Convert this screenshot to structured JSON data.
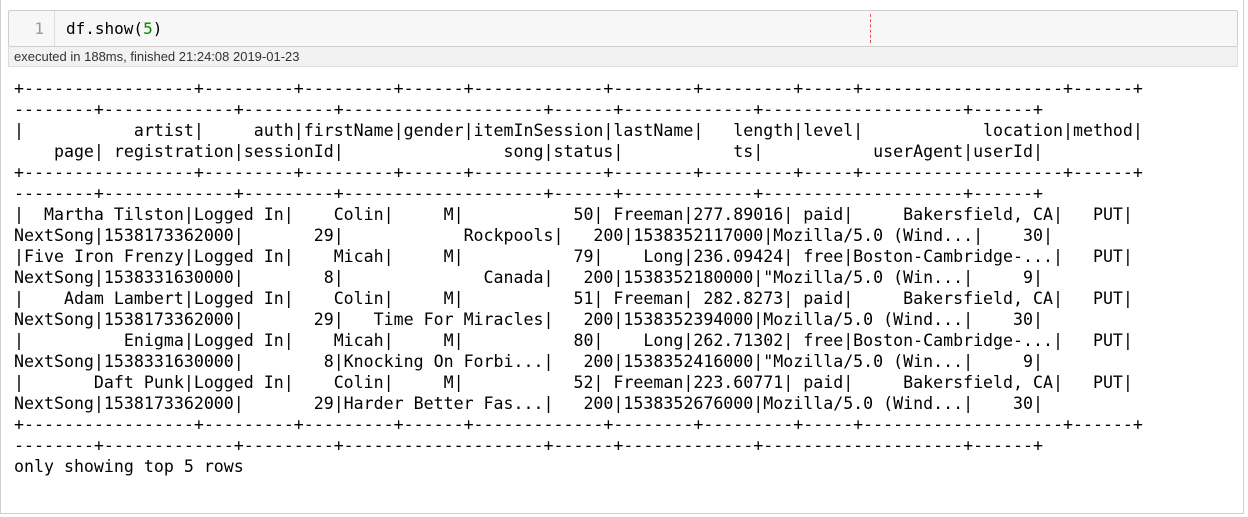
{
  "cell": {
    "line_number": "1",
    "code_prefix": "df.show(",
    "code_arg": "5",
    "code_suffix": ")",
    "execution_info": "executed in 188ms, finished 21:24:08 2019-01-23"
  },
  "output": {
    "lines": [
      "+-----------------+---------+---------+------+-------------+--------+---------+-----+--------------------+------+",
      "--------+-------------+---------+--------------------+------+-------------+--------------------+------+",
      "|           artist|     auth|firstName|gender|itemInSession|lastName|   length|level|            location|method|",
      "    page| registration|sessionId|                song|status|           ts|           userAgent|userId|",
      "+-----------------+---------+---------+------+-------------+--------+---------+-----+--------------------+------+",
      "--------+-------------+---------+--------------------+------+-------------+--------------------+------+",
      "|  Martha Tilston|Logged In|    Colin|     M|           50| Freeman|277.89016| paid|     Bakersfield, CA|   PUT|",
      "NextSong|1538173362000|       29|            Rockpools|   200|1538352117000|Mozilla/5.0 (Wind...|    30|",
      "|Five Iron Frenzy|Logged In|    Micah|     M|           79|    Long|236.09424| free|Boston-Cambridge-...|   PUT|",
      "NextSong|1538331630000|        8|              Canada|   200|1538352180000|\"Mozilla/5.0 (Win...|     9|",
      "|    Adam Lambert|Logged In|    Colin|     M|           51| Freeman| 282.8273| paid|     Bakersfield, CA|   PUT|",
      "NextSong|1538173362000|       29|   Time For Miracles|   200|1538352394000|Mozilla/5.0 (Wind...|    30|",
      "|          Enigma|Logged In|    Micah|     M|           80|    Long|262.71302| free|Boston-Cambridge-...|   PUT|",
      "NextSong|1538331630000|        8|Knocking On Forbi...|   200|1538352416000|\"Mozilla/5.0 (Win...|     9|",
      "|       Daft Punk|Logged In|    Colin|     M|           52| Freeman|223.60771| paid|     Bakersfield, CA|   PUT|",
      "NextSong|1538173362000|       29|Harder Better Fas...|   200|1538352676000|Mozilla/5.0 (Wind...|    30|",
      "+-----------------+---------+---------+------+-------------+--------+---------+-----+--------------------+------+",
      "--------+-------------+---------+--------------------+------+-------------+--------------------+------+",
      "only showing top 5 rows"
    ]
  }
}
